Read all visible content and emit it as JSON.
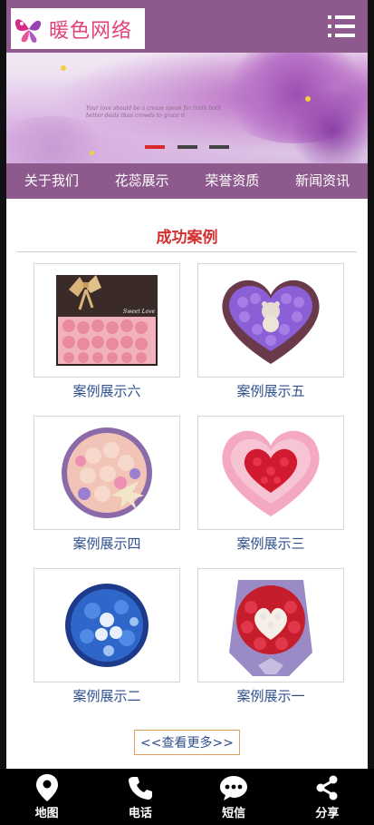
{
  "header": {
    "brand": "暖色网络",
    "menu_icon": "hamburger-menu-icon"
  },
  "banner": {
    "script_text": "Your love should be a cream speak for truth both better deals than crowds to grace it",
    "slides": 3,
    "active_slide": 1
  },
  "nav": {
    "items": [
      "关于我们",
      "花蕊展示",
      "荣誉资质",
      "新闻资讯"
    ]
  },
  "section": {
    "title": "成功案例"
  },
  "cases": [
    {
      "label": "案例展示六",
      "image": "pink-carnation-gift-box",
      "box_text": "Sweet Love"
    },
    {
      "label": "案例展示五",
      "image": "purple-heart-rose-box"
    },
    {
      "label": "案例展示四",
      "image": "round-mixed-flower-box"
    },
    {
      "label": "案例展示三",
      "image": "heart-red-pink-rose-box"
    },
    {
      "label": "案例展示二",
      "image": "blue-round-flower-box"
    },
    {
      "label": "案例展示一",
      "image": "heart-rose-bouquet"
    }
  ],
  "more": {
    "label": "<<查看更多>>"
  },
  "footer": {
    "items": [
      {
        "label": "地图",
        "icon": "map-pin-icon"
      },
      {
        "label": "电话",
        "icon": "phone-icon"
      },
      {
        "label": "短信",
        "icon": "sms-icon"
      },
      {
        "label": "分享",
        "icon": "share-icon"
      }
    ]
  },
  "colors": {
    "brand_purple": "#8e5a8e",
    "title_red": "#d32f2f",
    "link_blue": "#2f4f8f",
    "dot_active": "#d62a2a"
  }
}
